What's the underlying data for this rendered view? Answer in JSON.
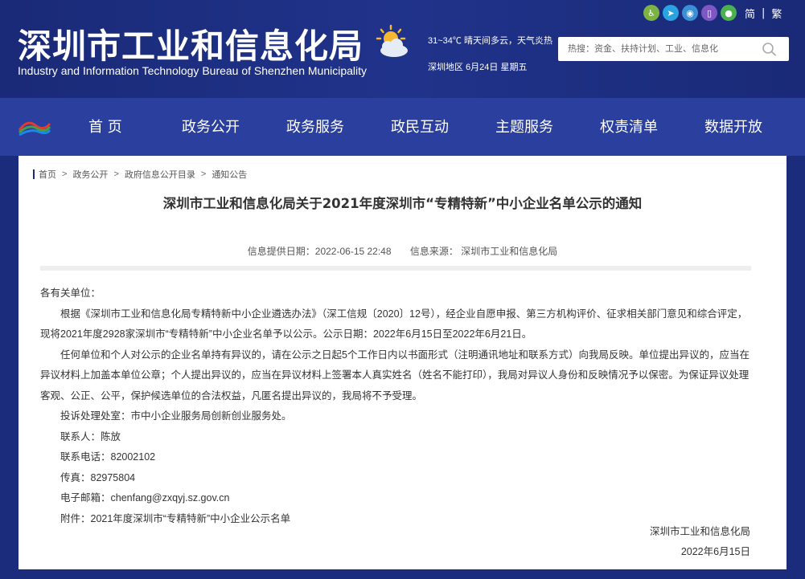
{
  "header": {
    "title_cn": "深圳市工业和信息化局",
    "title_en": "Industry and Information Technology Bureau of Shenzhen Municipality",
    "weather": "31~34℃  晴天间多云，天气炎热",
    "date": "深圳地区 6月24日  星期五",
    "lang_simplified": "简",
    "lang_separator": "|",
    "lang_traditional": "繁",
    "search_placeholder": "热搜：资金、扶持计划、工业、信息化",
    "top_icons": [
      "accessibility-icon",
      "telegram-icon",
      "robot-icon",
      "mobile-icon",
      "wechat-icon"
    ],
    "weather_icon": "sun-cloud-icon"
  },
  "nav": {
    "items": [
      "首 页",
      "政务公开",
      "政务服务",
      "政民互动",
      "主题服务",
      "权责清单",
      "数据开放"
    ]
  },
  "breadcrumb": {
    "items": [
      "首页",
      "政务公开",
      "政府信息公开目录",
      "通知公告"
    ],
    "separator": ">"
  },
  "article": {
    "title": "深圳市工业和信息化局关于2021年度深圳市“专精特新”中小企业名单公示的通知",
    "meta_date": "信息提供日期：2022-06-15 22:48",
    "meta_source": "信息来源：  深圳市工业和信息化局",
    "salutation": "各有关单位：",
    "para1": "根据《深圳市工业和信息化局专精特新中小企业遴选办法》（深工信规〔2020〕12号），经企业自愿申报、第三方机构评价、征求相关部门意见和综合评定，现将2021年度2928家深圳市“专精特新”中小企业名单予以公示。公示日期：2022年6月15日至2022年6月21日。",
    "para2": "任何单位和个人对公示的企业名单持有异议的，请在公示之日起5个工作日内以书面形式（注明通讯地址和联系方式）向我局反映。单位提出异议的，应当在异议材料上加盖本单位公章；个人提出异议的，应当在异议材料上签署本人真实姓名（姓名不能打印），我局对异议人身份和反映情况予以保密。为保证异议处理客观、公正、公平，保护候选单位的合法权益，凡匿名提出异议的，我局将不予受理。",
    "office": "投诉处理处室：市中小企业服务局创新创业服务处。",
    "contact": "联系人：陈放",
    "phone": "联系电话：82002102",
    "fax": "传真：82975804",
    "email": "电子邮箱：chenfang@zxqyj.sz.gov.cn",
    "attachment": "附件：2021年度深圳市“专精特新”中小企业公示名单",
    "sign_org": "深圳市工业和信息化局",
    "sign_date": "2022年6月15日"
  },
  "colors": {
    "header_bg": "#1a2a78",
    "nav_bg": "#2a3f9e",
    "panel_bg": "#ffffff"
  }
}
